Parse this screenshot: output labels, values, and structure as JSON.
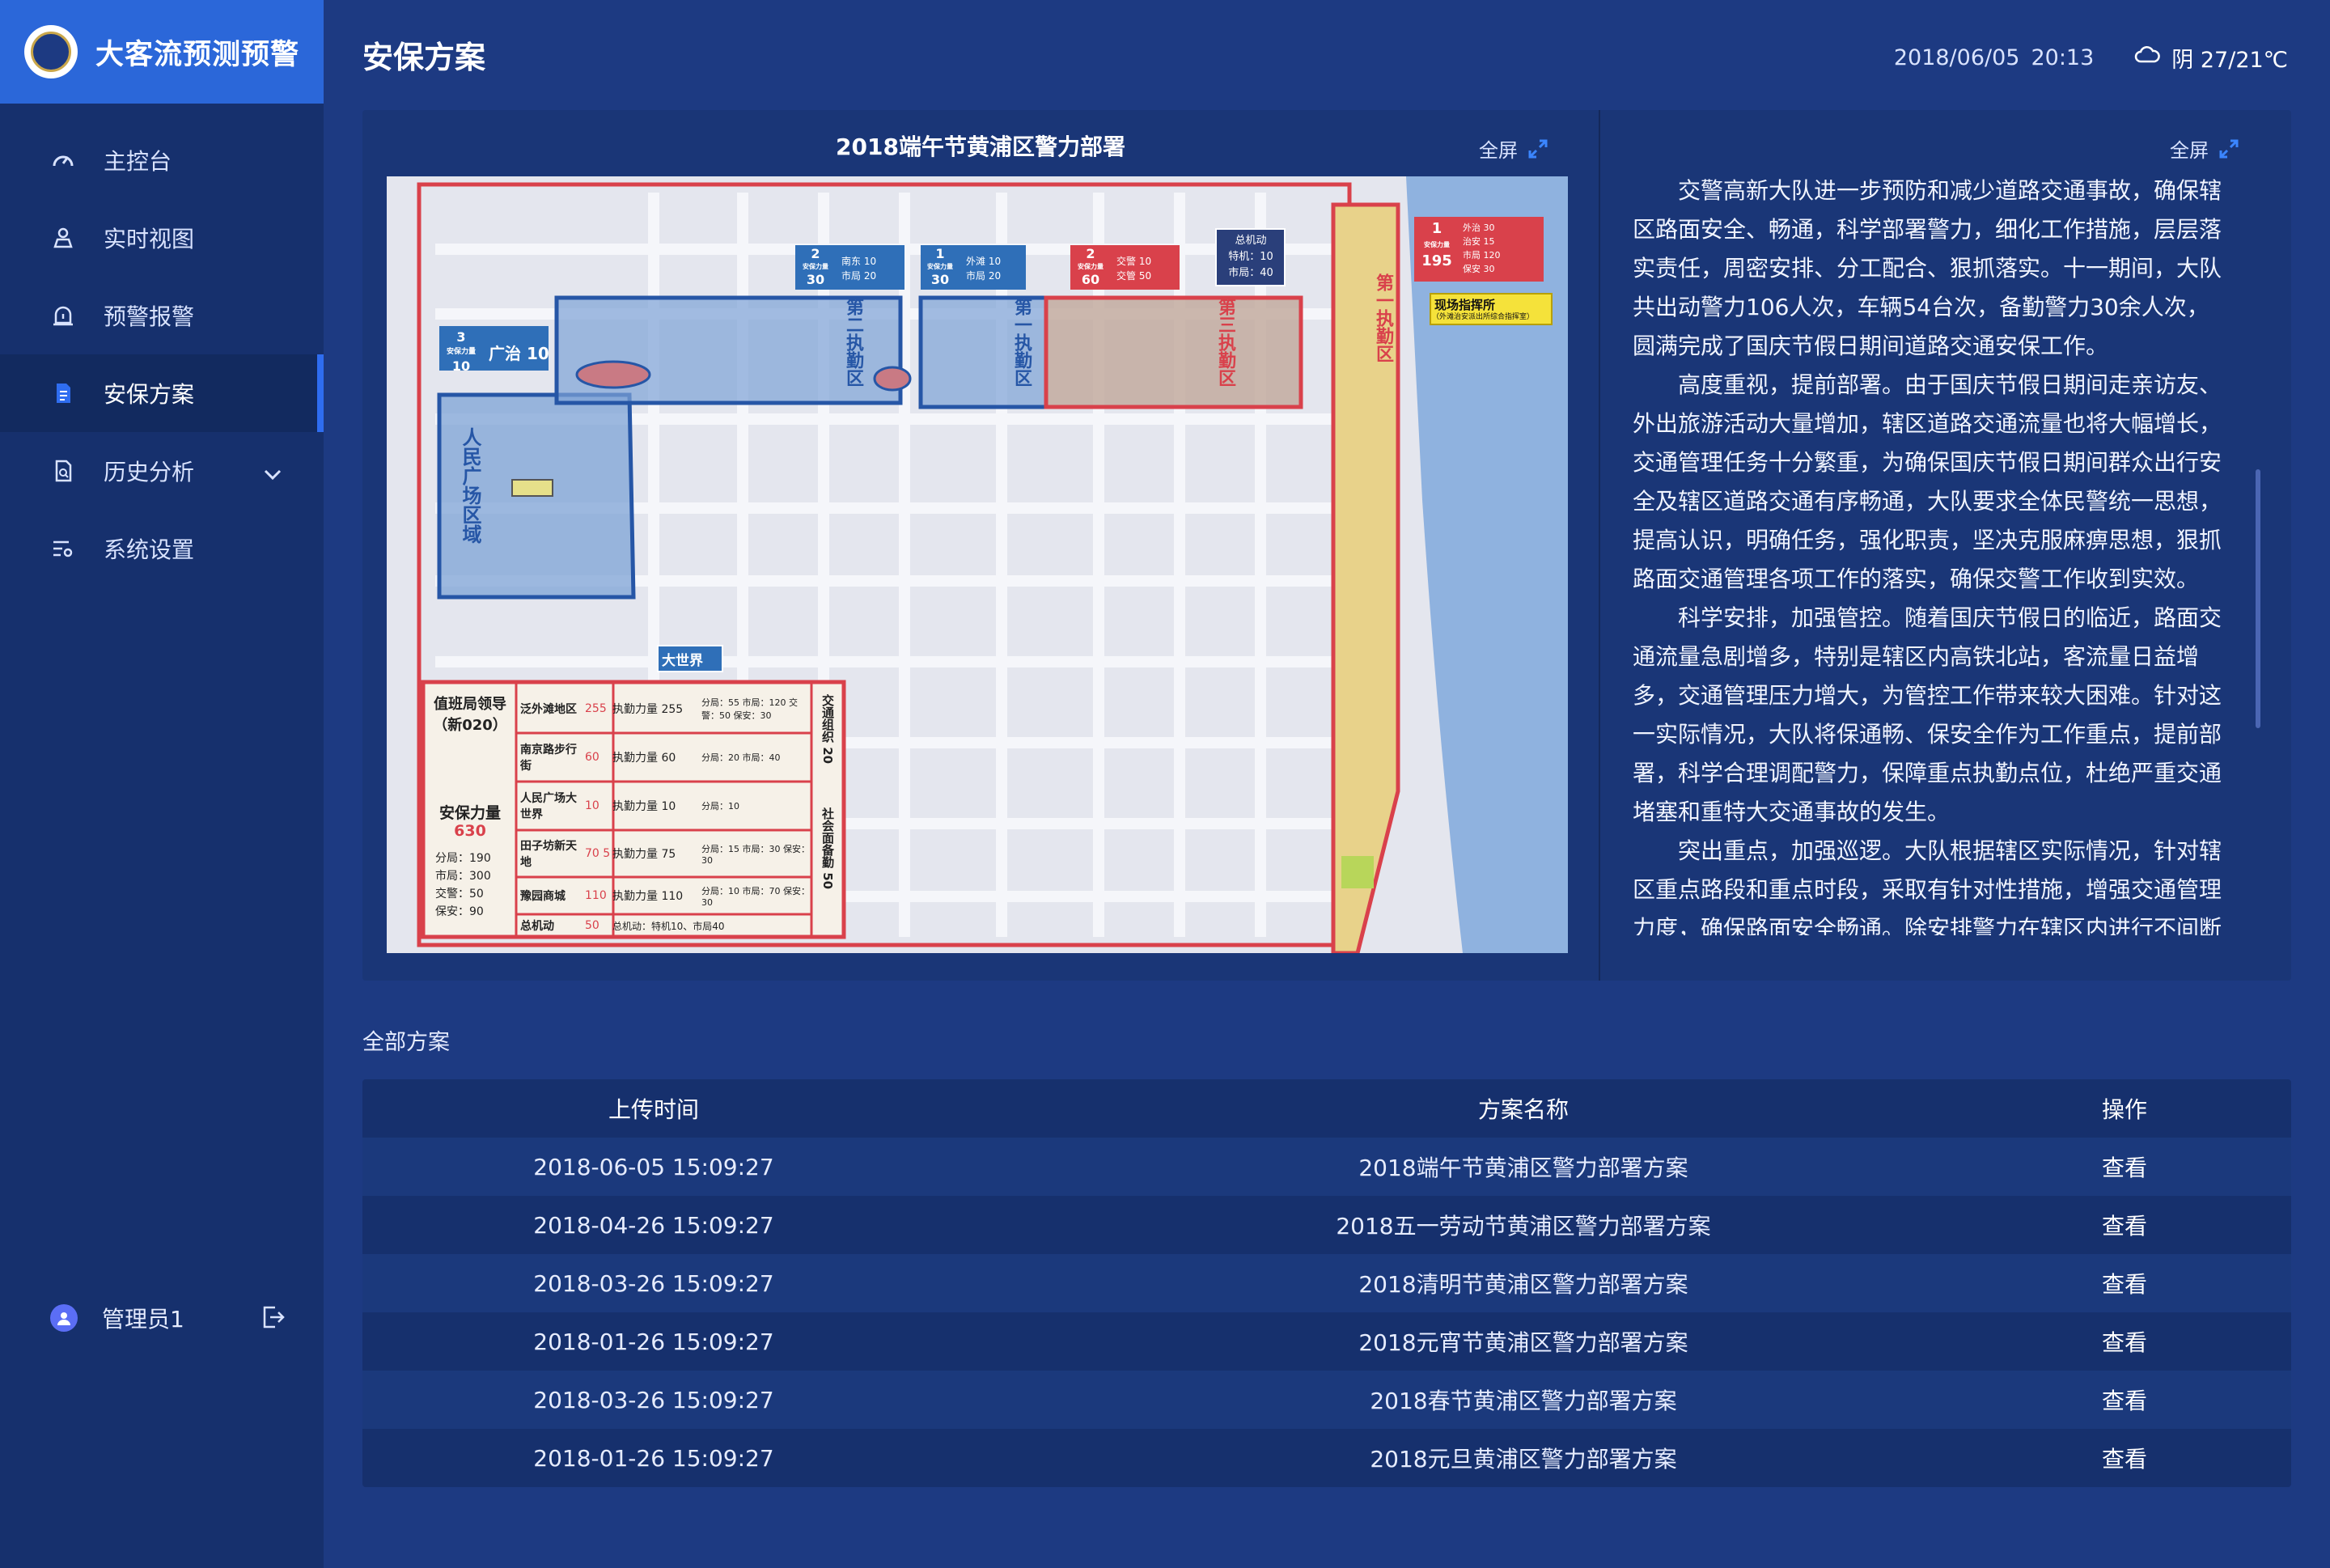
{
  "brand": {
    "name": "大客流预测预警"
  },
  "nav": [
    {
      "label": "主控台",
      "icon": "dashboard-icon"
    },
    {
      "label": "实时视图",
      "icon": "realtime-view-icon"
    },
    {
      "label": "预警报警",
      "icon": "alarm-icon"
    },
    {
      "label": "安保方案",
      "icon": "document-icon"
    },
    {
      "label": "历史分析",
      "icon": "history-icon"
    },
    {
      "label": "系统设置",
      "icon": "settings-icon"
    }
  ],
  "user": {
    "name": "管理员1"
  },
  "header": {
    "title": "安保方案",
    "date": "2018/06/05",
    "time": "20:13",
    "weather": "阴 27/21℃"
  },
  "panel": {
    "map_title": "2018端午节黄浦区警力部署",
    "fullscreen_label": "全屏",
    "paragraphs": [
      "交警高新大队进一步预防和减少道路交通事故，确保辖区路面安全、畅通，科学部署警力，细化工作措施，层层落实责任，周密安排、分工配合、狠抓落实。十一期间，大队共出动警力106人次，车辆54台次，备勤警力30余人次，圆满完成了国庆节假日期间道路交通安保工作。",
      "高度重视，提前部署。由于国庆节假日期间走亲访友、外出旅游活动大量增加，辖区道路交通流量也将大幅增长，交通管理任务十分繁重，为确保国庆节假日期间群众出行安全及辖区道路交通有序畅通，大队要求全体民警统一思想，提高认识，明确任务，强化职责，坚决克服麻痹思想，狠抓路面交通管理各项工作的落实，确保交警工作收到实效。",
      "科学安排，加强管控。随着国庆节假日的临近，路面交通流量急剧增多，特别是辖区内高铁北站，客流量日益增多，交通管理压力增大，为管控工作带来较大困难。针对这一实际情况，大队将保通畅、保安全作为工作重点，提前部署，科学合理调配警力，保障重点执勤点位，杜绝严重交通堵塞和重特大交通事故的发生。",
      "突出重点，加强巡逻。大队根据辖区实际情况，针对辖区重点路段和重点时段，采取有针对性措施，增强交通管理力度，确保路面安全畅通。除安排警力在辖区内进行不间断"
    ],
    "map": {
      "zones": [
        "第二执勤区",
        "第一执勤区",
        "第三执勤区",
        "第一执勤区"
      ],
      "square_zone": "人民广场区域",
      "great_world": "大世界",
      "command_post": "现场指挥所",
      "command_post_sub": "（外滩治安派出所综合指挥室）",
      "reserve": [
        "总机动",
        "特机：10",
        "市局：40"
      ],
      "badge_3": {
        "num": "3",
        "sub": "安保力量",
        "val": "10",
        "right": "广治 10"
      },
      "badge_2a": {
        "num": "2",
        "sub": "安保力量",
        "val": "30",
        "r1": "南东 10",
        "r2": "市局 20"
      },
      "badge_1a": {
        "num": "1",
        "sub": "安保力量",
        "val": "30",
        "r1": "外滩 10",
        "r2": "市局 20"
      },
      "badge_2b": {
        "num": "2",
        "sub": "安保力量",
        "val": "60",
        "r1": "交警 10",
        "r2": "交管 50"
      },
      "badge_1b": {
        "num": "1",
        "sub": "安保力量",
        "val": "195",
        "r1": "外治 30",
        "r2": "治安 15",
        "r3": "市局 120",
        "r4": "保安 30"
      },
      "legend": {
        "duty": "值班局领导（新020）",
        "force_title": "安保力量",
        "force_total": "630",
        "force_lines": [
          "分局：190",
          "市局：300",
          "交警：50",
          "保安：90"
        ],
        "rows": [
          {
            "area": "泛外滩地区",
            "val": "255",
            "exec": "执勤力量 255",
            "detail": "分局：55 市局：120 交警：50 保安：30"
          },
          {
            "area": "南京路步行街",
            "val": "60",
            "exec": "执勤力量 60",
            "detail": "分局：20 市局：40"
          },
          {
            "area": "人民广场大世界",
            "val": "10",
            "exec": "执勤力量 10",
            "detail": "分局：10"
          },
          {
            "area": "田子坊新天地",
            "val": "70 5",
            "exec": "执勤力量 75",
            "detail": "分局：15 市局：30 保安：30"
          },
          {
            "area": "豫园商城",
            "val": "110",
            "exec": "执勤力量 110",
            "detail": "分局：10 市局：70 保安：30"
          },
          {
            "area": "总机动",
            "val": "50",
            "exec": "总机动：特机10、市局40",
            "detail": ""
          }
        ],
        "side": "交通组织 20",
        "side2": "社会面备勤 50"
      }
    }
  },
  "table": {
    "section_title": "全部方案",
    "headers": [
      "上传时间",
      "方案名称",
      "操作"
    ],
    "rows": [
      {
        "time": "2018-06-05 15:09:27",
        "name": "2018端午节黄浦区警力部署方案",
        "action": "查看"
      },
      {
        "time": "2018-04-26 15:09:27",
        "name": "2018五一劳动节黄浦区警力部署方案",
        "action": "查看"
      },
      {
        "time": "2018-03-26 15:09:27",
        "name": "2018清明节黄浦区警力部署方案",
        "action": "查看"
      },
      {
        "time": "2018-01-26 15:09:27",
        "name": "2018元宵节黄浦区警力部署方案",
        "action": "查看"
      },
      {
        "time": "2018-03-26 15:09:27",
        "name": "2018春节黄浦区警力部署方案",
        "action": "查看"
      },
      {
        "time": "2018-01-26 15:09:27",
        "name": "2018元旦黄浦区警力部署方案",
        "action": "查看"
      }
    ]
  }
}
